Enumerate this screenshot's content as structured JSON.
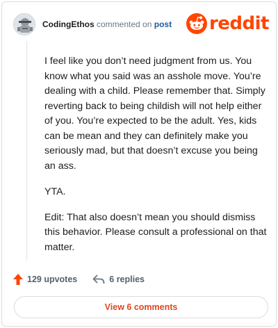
{
  "comment": {
    "author": "CodingEthos",
    "action_text": "commented on",
    "post_link": "post",
    "paragraphs": [
      "I feel like you don’t need judgment from us. You know what you said was an asshole move. You’re dealing with a child. Please remember that. Simply reverting back to being childish will not help either of you. You’re expected to be the adult. Yes, kids can be mean and they can definitely make you seriously mad, but that doesn’t excuse you being an ass.",
      "YTA.",
      "Edit: That also doesn’t mean you should dismiss this behavior. Please consult a professional on that matter."
    ]
  },
  "branding": {
    "logo_text": "reddit",
    "brand_color": "#ff4500"
  },
  "footer": {
    "upvotes": "129 upvotes",
    "replies": "6 replies",
    "upvote_color": "#ff4500",
    "view_comments": "View 6 comments",
    "view_comments_color": "#e0461d"
  },
  "icons": {
    "upvote": "upvote-arrow-icon",
    "reply": "reply-arrow-icon",
    "logo": "reddit-snoo-icon"
  }
}
